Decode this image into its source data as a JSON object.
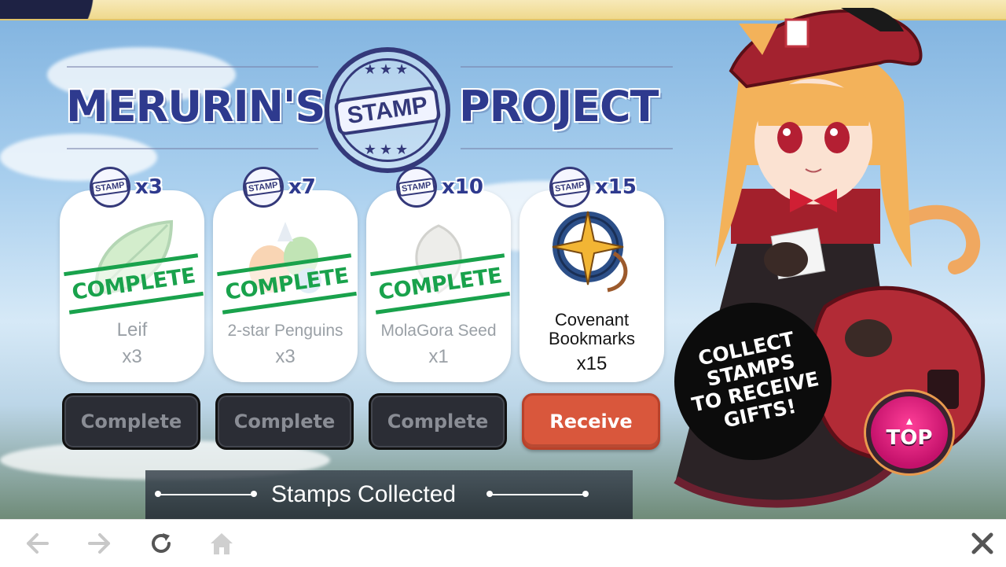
{
  "header": {
    "title_left": "MERURIN'S",
    "stamp_word": "STAMP",
    "title_right": "PROJECT"
  },
  "stamp_label": "STAMP",
  "rewards": [
    {
      "required": "x3",
      "label": "Leif",
      "qty": "x3",
      "stamp": "COMPLETE",
      "button": "Complete",
      "status": "complete",
      "icon": "leaf-icon"
    },
    {
      "required": "x7",
      "label": "2-star Penguins",
      "qty": "x3",
      "stamp": "COMPLETE",
      "button": "Complete",
      "status": "complete",
      "icon": "penguins-icon"
    },
    {
      "required": "x10",
      "label": "MolaGora Seed",
      "qty": "x1",
      "stamp": "COMPLETE",
      "button": "Complete",
      "status": "complete",
      "icon": "seed-icon"
    },
    {
      "required": "x15",
      "label_line1": "Covenant",
      "label_line2": "Bookmarks",
      "qty": "x15",
      "button": "Receive",
      "status": "receivable",
      "icon": "bookmark-icon"
    }
  ],
  "collected": {
    "title": "Stamps Collected"
  },
  "speech": {
    "text": "COLLECT\nSTAMPS\nTO RECEIVE\nGIFTS!"
  },
  "top_button": {
    "label": "TOP",
    "icon": "chevron-up-icon"
  },
  "browser": {
    "icons": [
      "back-arrow-icon",
      "forward-arrow-icon",
      "reload-icon",
      "home-icon",
      "close-icon"
    ]
  },
  "colors": {
    "title": "#2e3a8e",
    "complete_green": "#19a24c",
    "receive_button": "#d9573c",
    "disabled_button": "#2b2d35",
    "top_button": "#e51c82"
  }
}
